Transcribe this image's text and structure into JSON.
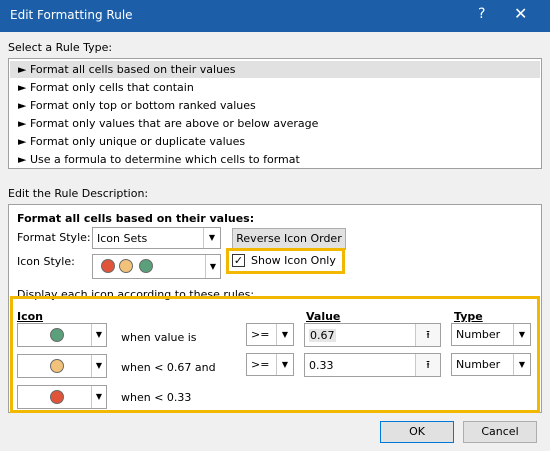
{
  "window": {
    "title": "Edit Formatting Rule",
    "help_glyph": "?",
    "close_glyph": "✕"
  },
  "rule_type": {
    "heading": "Select a Rule Type:",
    "items": [
      "Format all cells based on their values",
      "Format only cells that contain",
      "Format only top or bottom ranked values",
      "Format only values that are above or below average",
      "Format only unique or duplicate values",
      "Use a formula to determine which cells to format"
    ],
    "bullet": "►",
    "selected_index": 0
  },
  "description": {
    "heading": "Edit the Rule Description:",
    "subheading": "Format all cells based on their values:",
    "format_style_label": "Format Style:",
    "format_style_value": "Icon Sets",
    "reverse_button": "Reverse Icon Order",
    "icon_style_label": "Icon Style:",
    "show_icon_only_label": "Show Icon Only",
    "show_icon_only_checked": true,
    "display_rules_label": "Display each icon according to these rules:",
    "headers": {
      "icon": "Icon",
      "value": "Value",
      "type": "Type"
    },
    "rows": [
      {
        "icon_color": "#5aa07a",
        "condition": "when value is",
        "operator": ">=",
        "value": "0.67",
        "type": "Number"
      },
      {
        "icon_color": "#f2c27a",
        "condition": "when < 0.67 and",
        "operator": ">=",
        "value": "0.33",
        "type": "Number"
      },
      {
        "icon_color": "#e0553a",
        "condition": "when < 0.33"
      }
    ]
  },
  "icon_style_colors": [
    "#e0553a",
    "#f2c27a",
    "#5aa07a"
  ],
  "buttons": {
    "ok": "OK",
    "cancel": "Cancel"
  },
  "colors": {
    "title_bar": "#1c5fa8",
    "highlight": "#f2b800"
  }
}
